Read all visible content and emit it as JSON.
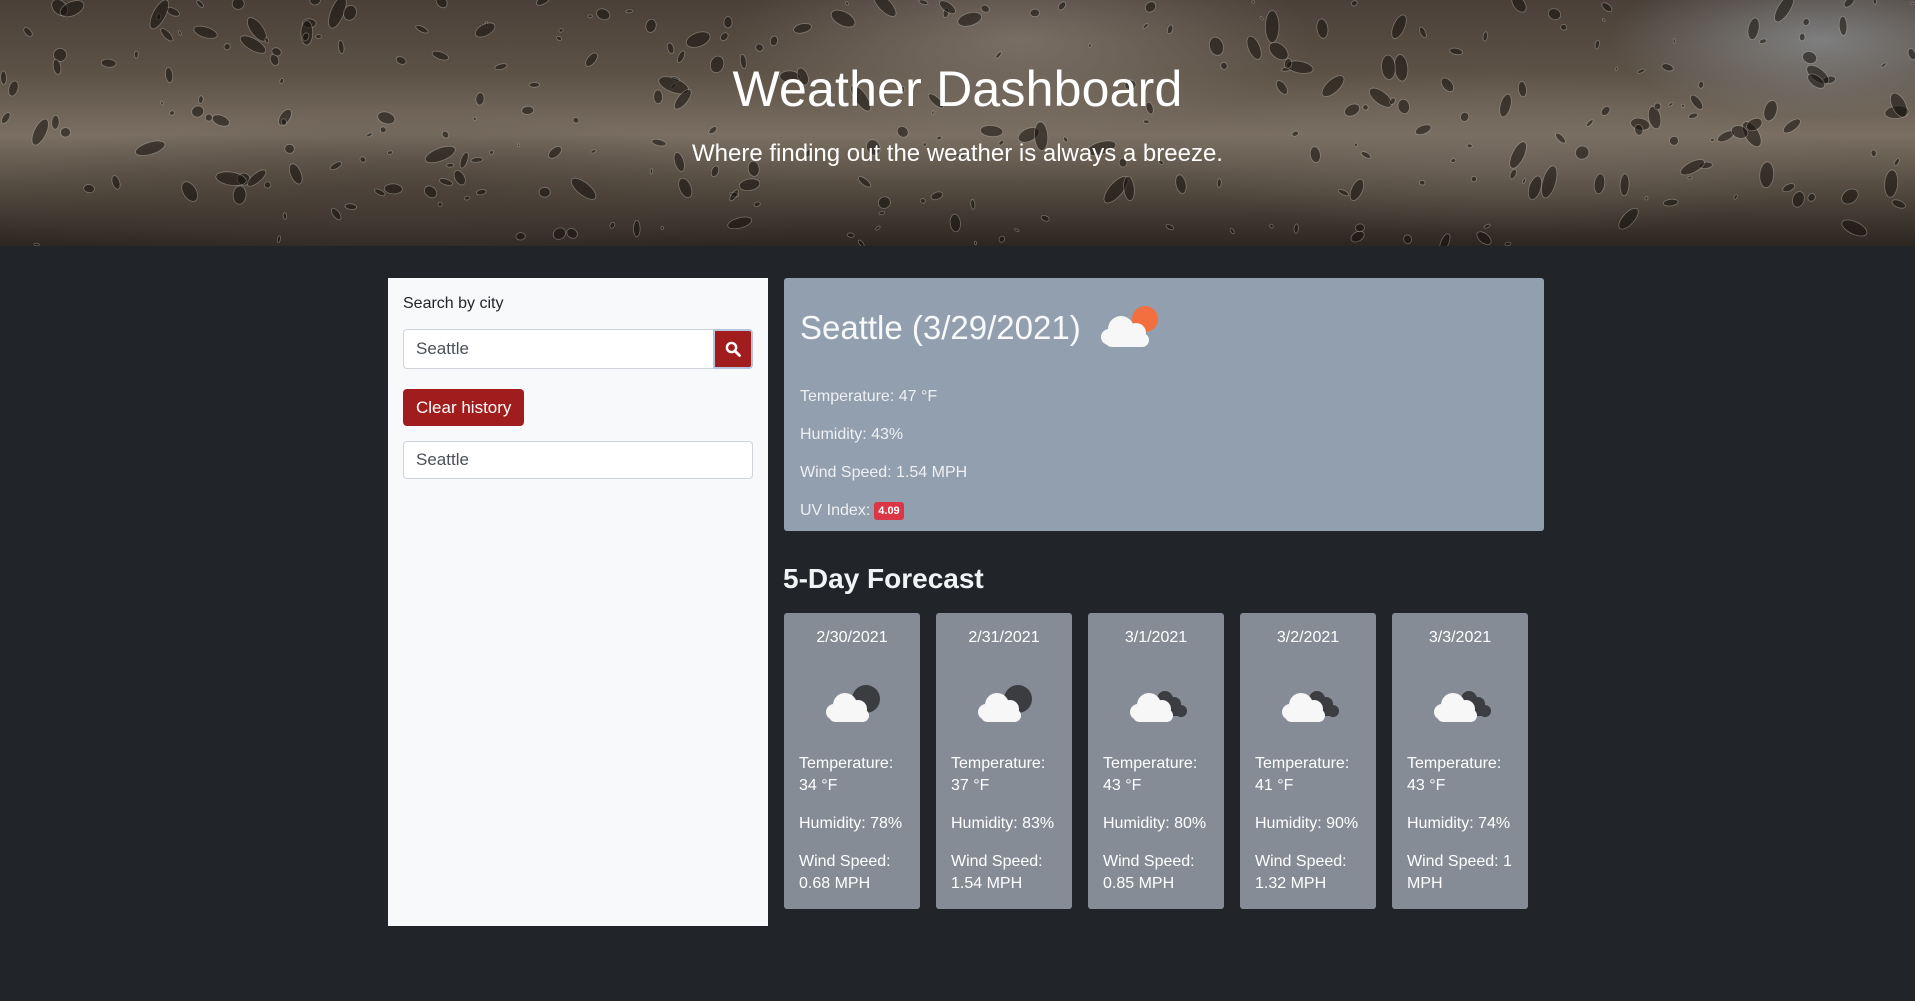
{
  "hero": {
    "title": "Weather Dashboard",
    "subtitle": "Where finding out the weather is always a breeze."
  },
  "sidebar": {
    "search_label": "Search by city",
    "search_value": "Seattle",
    "search_button_icon": "search-icon",
    "clear_button_label": "Clear history",
    "history": [
      {
        "label": "Seattle"
      }
    ]
  },
  "current": {
    "title": "Seattle (3/29/2021)",
    "icon": "cloud-sun-icon",
    "temperature": "Temperature: 47 °F",
    "humidity": "Humidity: 43%",
    "wind": "Wind Speed: 1.54 MPH",
    "uv_label": "UV Index:",
    "uv_value": "4.09"
  },
  "forecast": {
    "title": "5-Day Forecast",
    "days": [
      {
        "date": "2/30/2021",
        "icon": "cloud-moon-icon",
        "temp": "Temperature: 34 °F",
        "humidity": "Humidity: 78%",
        "wind": "Wind Speed: 0.68 MPH"
      },
      {
        "date": "2/31/2021",
        "icon": "cloud-moon-icon",
        "temp": "Temperature: 37 °F",
        "humidity": "Humidity: 83%",
        "wind": "Wind Speed: 1.54 MPH"
      },
      {
        "date": "3/1/2021",
        "icon": "clouds-icon",
        "temp": "Temperature: 43 °F",
        "humidity": "Humidity: 80%",
        "wind": "Wind Speed: 0.85 MPH"
      },
      {
        "date": "3/2/2021",
        "icon": "clouds-icon",
        "temp": "Temperature: 41 °F",
        "humidity": "Humidity: 90%",
        "wind": "Wind Speed: 1.32 MPH"
      },
      {
        "date": "3/3/2021",
        "icon": "clouds-icon",
        "temp": "Temperature: 43 °F",
        "humidity": "Humidity: 74%",
        "wind": "Wind Speed: 1 MPH"
      }
    ]
  },
  "colors": {
    "accent_red": "#a11d1d",
    "uv_badge": "#dc3545",
    "current_panel": "#919fae",
    "forecast_card": "#858c96",
    "page_bg": "#212529"
  }
}
